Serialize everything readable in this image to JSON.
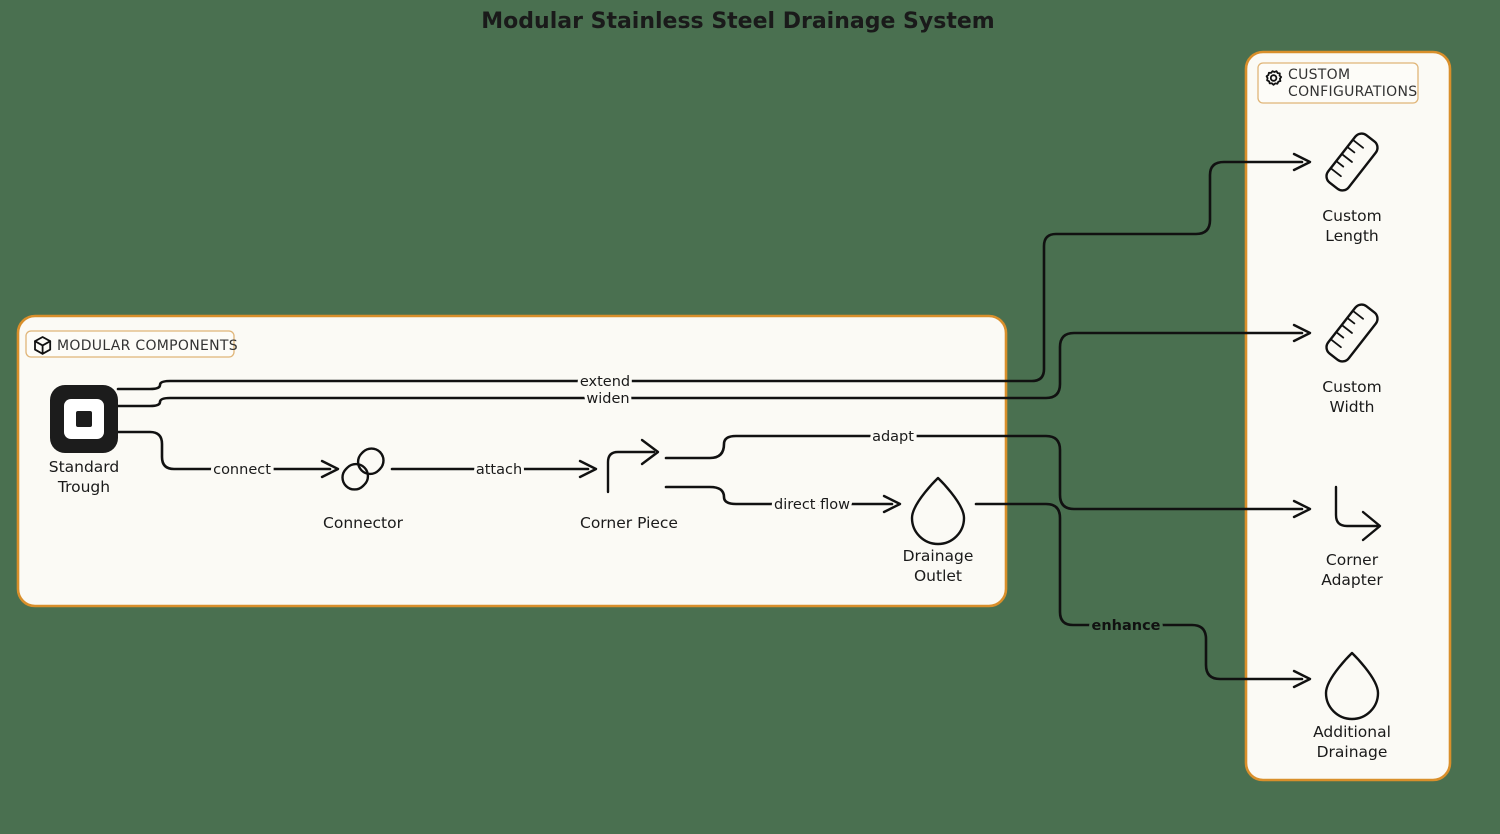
{
  "title": "Modular Stainless Steel Drainage System",
  "theme": {
    "background": "#4a7050",
    "container_fill": "#fbfaf5",
    "container_border": "#d98f2b",
    "edge_color": "#111111",
    "text_color": "#1a1a1a"
  },
  "clusters": [
    {
      "id": "modular-components",
      "label": "MODULAR COMPONENTS",
      "icon": "package-icon"
    },
    {
      "id": "custom-configurations",
      "label_line1": "CUSTOM",
      "label_line2": "CONFIGURATIONS",
      "icon": "gear-icon"
    }
  ],
  "nodes": [
    {
      "id": "standard-trough",
      "label_line1": "Standard",
      "label_line2": "Trough",
      "icon": "trough-square-icon",
      "cluster": "modular-components"
    },
    {
      "id": "connector",
      "label_line1": "Connector",
      "label_line2": "",
      "icon": "chain-link-icon",
      "cluster": "modular-components"
    },
    {
      "id": "corner-piece",
      "label_line1": "Corner Piece",
      "label_line2": "",
      "icon": "corner-up-right-arrow-icon",
      "cluster": "modular-components"
    },
    {
      "id": "drainage-outlet",
      "label_line1": "Drainage",
      "label_line2": "Outlet",
      "icon": "droplet-icon",
      "cluster": "modular-components"
    },
    {
      "id": "custom-length",
      "label_line1": "Custom",
      "label_line2": "Length",
      "icon": "ruler-icon",
      "cluster": "custom-configurations"
    },
    {
      "id": "custom-width",
      "label_line1": "Custom",
      "label_line2": "Width",
      "icon": "ruler-icon",
      "cluster": "custom-configurations"
    },
    {
      "id": "corner-adapter",
      "label_line1": "Corner",
      "label_line2": "Adapter",
      "icon": "corner-down-right-arrow-icon",
      "cluster": "custom-configurations"
    },
    {
      "id": "additional-drainage",
      "label_line1": "Additional",
      "label_line2": "Drainage",
      "icon": "droplet-icon",
      "cluster": "custom-configurations"
    }
  ],
  "edges": [
    {
      "id": "edge-connect",
      "from": "standard-trough",
      "to": "connector",
      "label": "connect"
    },
    {
      "id": "edge-attach",
      "from": "connector",
      "to": "corner-piece",
      "label": "attach"
    },
    {
      "id": "edge-direct-flow",
      "from": "corner-piece",
      "to": "drainage-outlet",
      "label": "direct flow"
    },
    {
      "id": "edge-extend",
      "from": "standard-trough",
      "to": "custom-length",
      "label": "extend"
    },
    {
      "id": "edge-widen",
      "from": "standard-trough",
      "to": "custom-width",
      "label": "widen"
    },
    {
      "id": "edge-adapt",
      "from": "corner-piece",
      "to": "corner-adapter",
      "label": "adapt"
    },
    {
      "id": "edge-enhance",
      "from": "drainage-outlet",
      "to": "additional-drainage",
      "label": "enhance"
    }
  ]
}
